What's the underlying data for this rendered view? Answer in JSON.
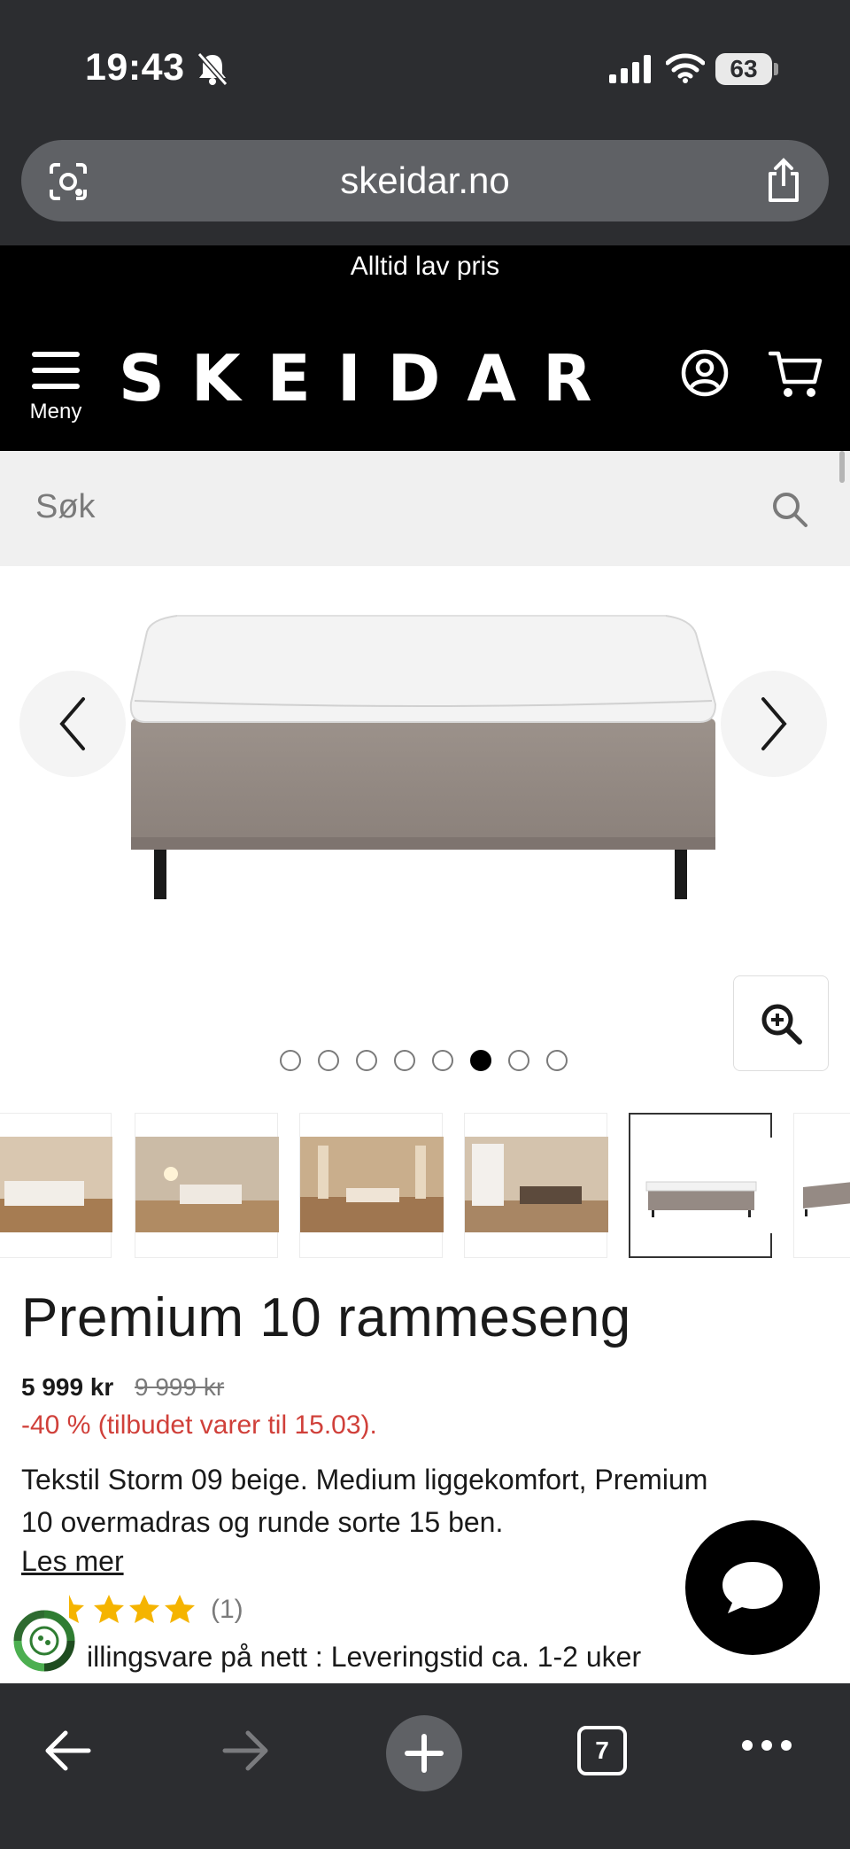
{
  "status_bar": {
    "time": "19:43",
    "battery": "63"
  },
  "browser": {
    "url": "skeidar.no",
    "tab_count": "7"
  },
  "site": {
    "promo": "Alltid lav pris",
    "logo": "SKEIDAR",
    "menu_label": "Meny",
    "search_placeholder": "Søk"
  },
  "gallery": {
    "dot_count": 8,
    "active_dot": 6
  },
  "product": {
    "title": "Premium 10 rammeseng",
    "price": "5 999 kr",
    "old_price": "9 999 kr",
    "discount": "-40 % (tilbudet varer til 15.03).",
    "description": "Tekstil Storm 09 beige. Medium liggekomfort, Premium 10 overmadras og runde sorte 15 ben.",
    "read_more": "Les mer",
    "rating_count": "(1)",
    "delivery": "illingsvare på nett : Leveringstid ca. 1-2 uker"
  },
  "colors": {
    "accent_discount": "#d0403a",
    "star": "#f5b400",
    "header_bg": "#000000"
  }
}
